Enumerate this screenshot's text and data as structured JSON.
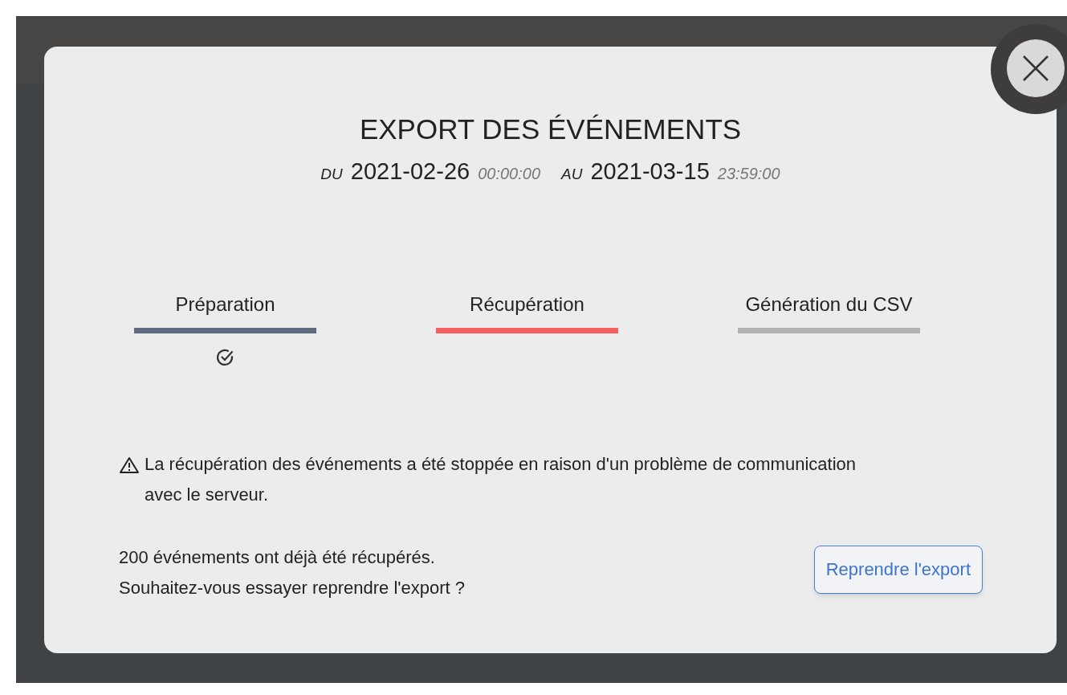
{
  "modal": {
    "title": "EXPORT DES ÉVÉNEMENTS",
    "range": {
      "from_label": "DU",
      "from_date": "2021-02-26",
      "from_time": "00:00:00",
      "to_label": "AU",
      "to_date": "2021-03-15",
      "to_time": "23:59:00"
    },
    "steps": [
      {
        "label": "Préparation",
        "done": true,
        "color": "#5f6b80"
      },
      {
        "label": "Récupération",
        "done": false,
        "color": "#f76060"
      },
      {
        "label": "Génération du CSV",
        "done": false,
        "color": "#b3b3b3"
      }
    ],
    "warning": "La récupération des événements a été stoppée en raison d'un problème de communication avec le serveur.",
    "info_lines": [
      "200 événements ont déjà été récupérés.",
      "Souhaitez-vous essayer reprendre l'export ?"
    ],
    "button": "Reprendre l'export"
  }
}
